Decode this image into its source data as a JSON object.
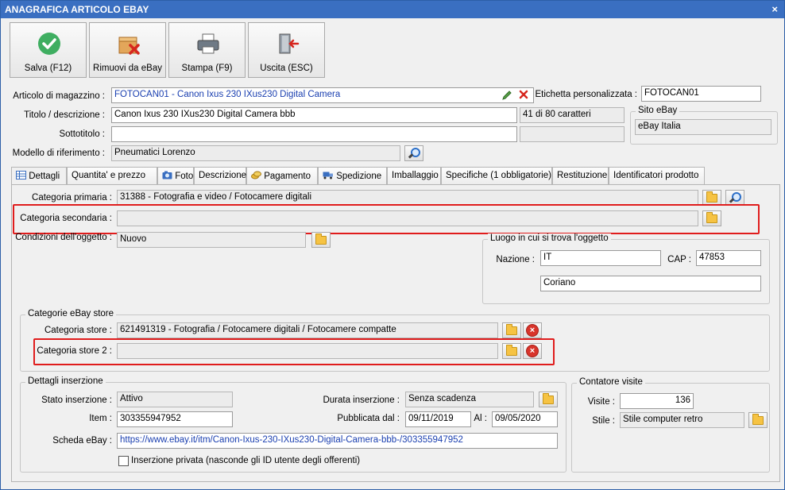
{
  "window": {
    "title": "ANAGRAFICA ARTICOLO EBAY",
    "close_glyph": "×"
  },
  "toolbar": {
    "save": "Salva (F12)",
    "remove": "Rimuovi da eBay",
    "print": "Stampa (F9)",
    "exit": "Uscita (ESC)"
  },
  "header": {
    "article_label": "Articolo di magazzino :",
    "article_value": "FOTOCAN01 - Canon Ixus 230 IXus230 Digital Camera",
    "custom_label_label": "Etichetta personalizzata :",
    "custom_label_value": "FOTOCAN01",
    "title_label": "Titolo / descrizione :",
    "title_value": "Canon Ixus 230 IXus230 Digital Camera bbb",
    "char_count": "41 di 80 caratteri",
    "subtitle_label": "Sottotitolo :",
    "subtitle_value": "",
    "model_label": "Modello di riferimento :",
    "model_value": "Pneumatici Lorenzo",
    "site_group_title": "Sito eBay",
    "site_value": "eBay Italia"
  },
  "tabs": [
    "Dettagli",
    "Quantita' e prezzo",
    "Foto",
    "Descrizione",
    "Pagamento",
    "Spedizione",
    "Imballaggio",
    "Specifiche (1 obbligatorie)",
    "Restituzione",
    "Identificatori prodotto"
  ],
  "details": {
    "primary_category_label": "Categoria primaria :",
    "primary_category_value": "31388 - Fotografia e video / Fotocamere digitali",
    "secondary_category_label": "Categoria secondaria :",
    "secondary_category_value": "",
    "condition_label": "Condizioni dell'oggetto :",
    "condition_value": "Nuovo",
    "location_group_title": "Luogo in cui si trova l'oggetto",
    "nation_label": "Nazione :",
    "nation_value": "IT",
    "cap_label": "CAP :",
    "cap_value": "47853",
    "city_value": "Coriano",
    "store_group_title": "Categorie eBay store",
    "store_category_label": "Categoria store :",
    "store_category_value": "621491319 - Fotografia / Fotocamere digitali / Fotocamere compatte",
    "store_category2_label": "Categoria store 2 :",
    "store_category2_value": "",
    "listing_group_title": "Dettagli inserzione",
    "status_label": "Stato inserzione :",
    "status_value": "Attivo",
    "duration_label": "Durata inserzione :",
    "duration_value": "Senza scadenza",
    "item_label": "Item :",
    "item_value": "303355947952",
    "published_label": "Pubblicata dal :",
    "published_from": "09/11/2019",
    "to_label": "Al :",
    "published_to": "09/05/2020",
    "sheet_label": "Scheda eBay :",
    "sheet_url": "https://www.ebay.it/itm/Canon-Ixus-230-IXus230-Digital-Camera-bbb-/303355947952",
    "private_label": "Inserzione privata (nasconde gli ID utente degli offerenti)",
    "private_checked": false,
    "counter_group_title": "Contatore visite",
    "visits_label": "Visite :",
    "visits_value": "136",
    "style_label": "Stile :",
    "style_value": "Stile computer retro"
  },
  "colors": {
    "titlebar": "#3a6fc1",
    "highlight": "#e01c1c",
    "link": "#1a3fb0"
  }
}
